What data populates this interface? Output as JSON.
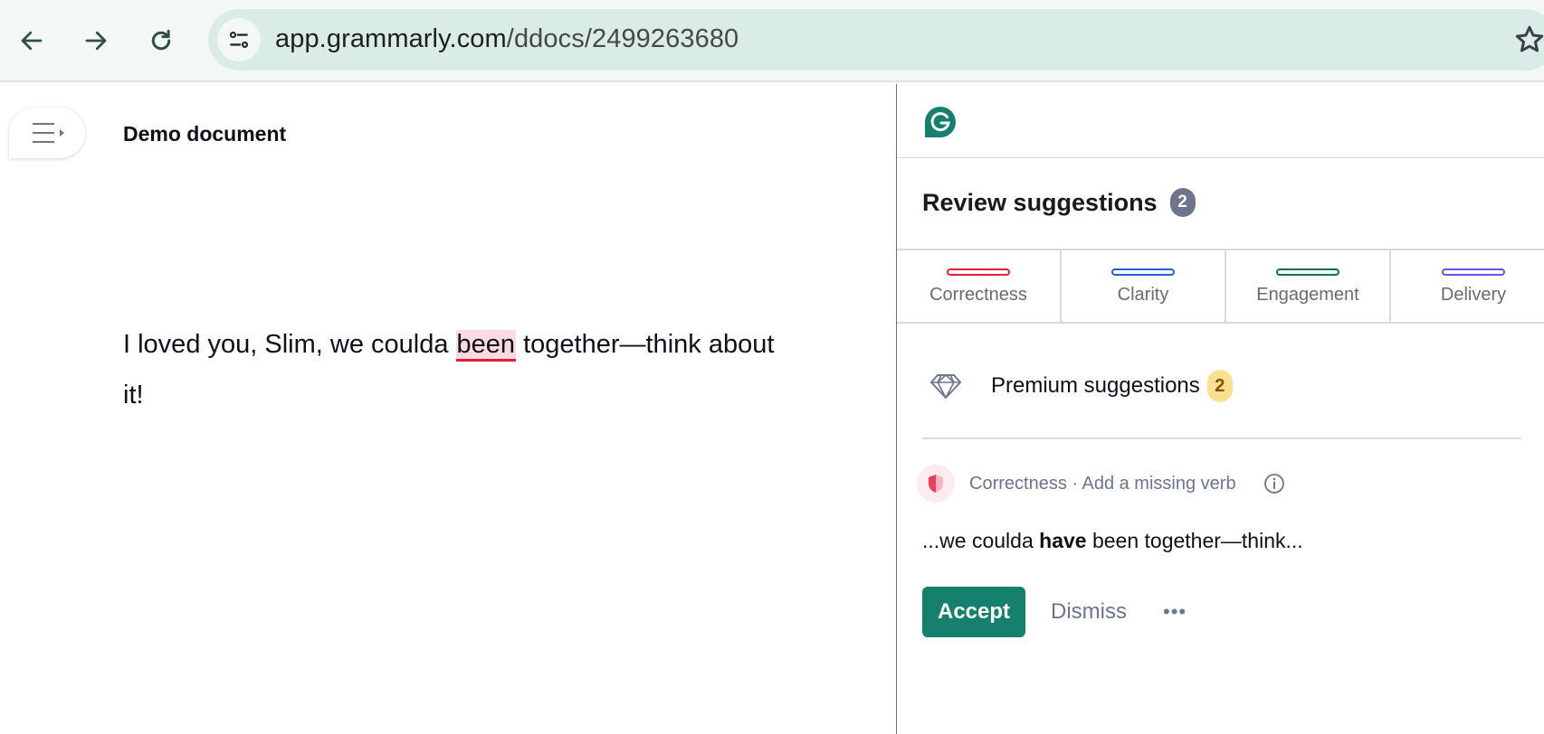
{
  "browser": {
    "url_host": "app.grammarly.com",
    "url_path": "/ddocs/2499263680",
    "icons": {
      "back": "arrow-left-icon",
      "forward": "arrow-right-icon",
      "reload": "reload-icon",
      "site_info": "tune-icon",
      "bookmark": "star-icon"
    }
  },
  "editor": {
    "doc_title": "Demo document",
    "text_before": "I loved you, Slim, we coulda ",
    "flagged_word": "been",
    "text_after": " together—think about it!",
    "menu_icon": "menu-icon"
  },
  "panel": {
    "logo": "grammarly-logo",
    "review_title": "Review suggestions",
    "review_count": "2",
    "tabs": [
      {
        "label": "Correctness",
        "color": "#e51d3d"
      },
      {
        "label": "Clarity",
        "color": "#2d5bd7"
      },
      {
        "label": "Engagement",
        "color": "#0f6e5a"
      },
      {
        "label": "Delivery",
        "color": "#6b52e0"
      }
    ],
    "premium": {
      "label": "Premium suggestions",
      "count": "2",
      "icon": "diamond-icon"
    },
    "card": {
      "category": "Correctness · Add a missing verb",
      "snippet_before": "...we coulda ",
      "snippet_insert": "have",
      "snippet_after": " been together—think...",
      "accept_label": "Accept",
      "dismiss_label": "Dismiss",
      "more_label": "•••"
    }
  },
  "colors": {
    "brand": "#15806e",
    "error": "#e51d3d",
    "highlight": "#fdd9e0"
  }
}
